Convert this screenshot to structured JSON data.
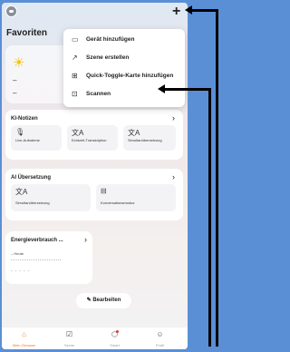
{
  "header": {
    "add_icon": "+"
  },
  "favorites_title": "Favoriten",
  "weather_card": {
    "line1": "–",
    "line2": "–"
  },
  "dropdown": {
    "items": [
      {
        "icon": "add-device-icon",
        "label": "Gerät hinzufügen"
      },
      {
        "icon": "create-scene-icon",
        "label": "Szene erstellen"
      },
      {
        "icon": "quick-toggle-icon",
        "label": "Quick-Toggle-Karte hinzufügen"
      },
      {
        "icon": "scan-icon",
        "label": "Scannen"
      }
    ]
  },
  "ki_card": {
    "title": "KI-Notizen",
    "tiles": [
      {
        "icon": "microphone-icon",
        "label": "Live-Aufnahme"
      },
      {
        "icon": "translate-icon",
        "label": "Echtzeit-Transkription"
      },
      {
        "icon": "translate-icon",
        "label": "Simultanübersetzung"
      }
    ]
  },
  "ai_card": {
    "title": "AI Übersetzung",
    "tiles": [
      {
        "icon": "translate-icon",
        "label": "Simultanübersetzung"
      },
      {
        "icon": "conversation-icon",
        "label": "Konversationsmodus"
      }
    ]
  },
  "energy_card": {
    "title": "Energieverbrauch ...",
    "period": "Heute",
    "value": "-----"
  },
  "edit_button": {
    "label": "Bearbeiten"
  },
  "nav": {
    "items": [
      {
        "icon": "home-icon",
        "label": "Mein Zuhause"
      },
      {
        "icon": "scene-icon",
        "label": "Szene"
      },
      {
        "icon": "smart-icon",
        "label": "Smart"
      },
      {
        "icon": "profile-icon",
        "label": "Profil"
      }
    ]
  },
  "colors": {
    "background": "#5a8fd6",
    "accent": "#f07a2a",
    "badge": "#e53935"
  }
}
